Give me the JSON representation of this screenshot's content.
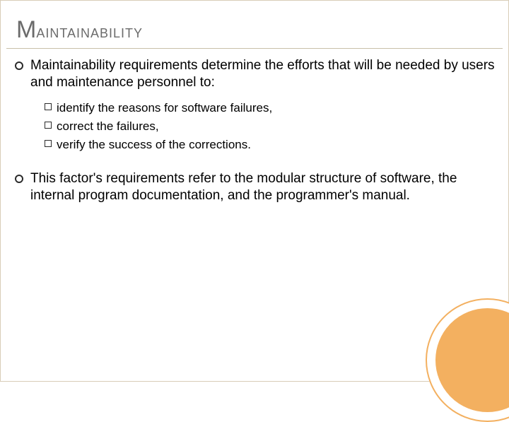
{
  "title_first": "M",
  "title_rest": "aintainability",
  "para1": "Maintainability requirements determine the efforts that will be needed by users and maintenance personnel to:",
  "sub1": "identify the reasons for software failures,",
  "sub2": "correct the failures,",
  "sub3": "verify the success of the corrections.",
  "para2": "This factor's requirements refer to the modular structure of software, the internal program documentation, and the programmer's manual."
}
